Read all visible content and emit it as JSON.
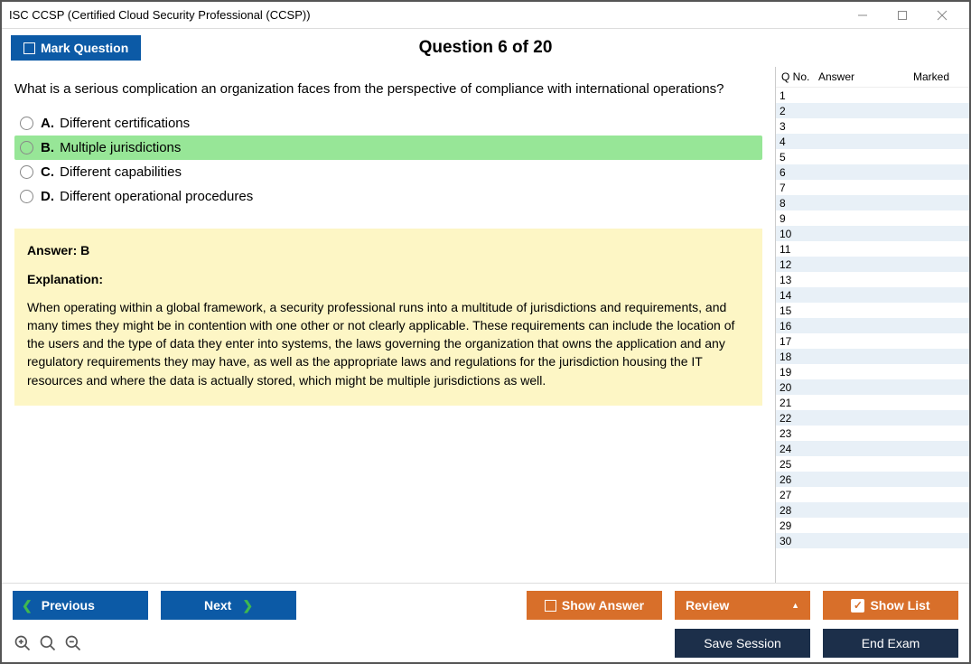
{
  "window": {
    "title": "ISC CCSP (Certified Cloud Security Professional (CCSP))"
  },
  "toolbar": {
    "mark": "Mark Question"
  },
  "question": {
    "heading": "Question 6 of 20",
    "text": "What is a serious complication an organization faces from the perspective of compliance with international operations?",
    "options": [
      {
        "letter": "A.",
        "text": "Different certifications",
        "selected": false
      },
      {
        "letter": "B.",
        "text": "Multiple jurisdictions",
        "selected": true
      },
      {
        "letter": "C.",
        "text": "Different capabilities",
        "selected": false
      },
      {
        "letter": "D.",
        "text": "Different operational procedures",
        "selected": false
      }
    ]
  },
  "answer": {
    "line": "Answer: B",
    "exp_label": "Explanation:",
    "exp_text": "When operating within a global framework, a security professional runs into a multitude of jurisdictions and requirements, and many times they might be in contention with one other or not clearly applicable. These requirements can include the location of the users and the type of data they enter into systems, the laws governing the organization that owns the application and any regulatory requirements they may have, as well as the appropriate laws and regulations for the jurisdiction housing the IT resources and where the data is actually stored, which might be multiple jurisdictions as well."
  },
  "sidebar": {
    "headers": {
      "qno": "Q No.",
      "answer": "Answer",
      "marked": "Marked"
    },
    "rows": [
      1,
      2,
      3,
      4,
      5,
      6,
      7,
      8,
      9,
      10,
      11,
      12,
      13,
      14,
      15,
      16,
      17,
      18,
      19,
      20,
      21,
      22,
      23,
      24,
      25,
      26,
      27,
      28,
      29,
      30
    ]
  },
  "buttons": {
    "previous": "Previous",
    "next": "Next",
    "show_answer": "Show Answer",
    "review": "Review",
    "show_list": "Show List",
    "save_session": "Save Session",
    "end_exam": "End Exam"
  }
}
